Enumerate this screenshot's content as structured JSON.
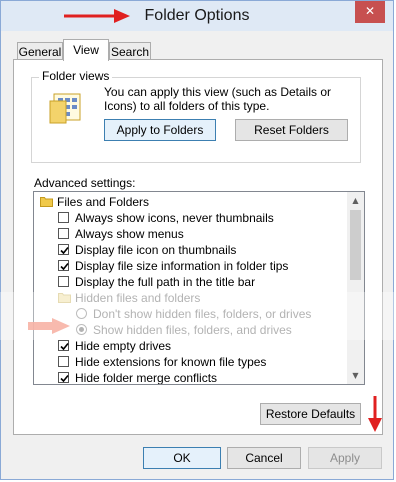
{
  "window": {
    "title": "Folder Options",
    "close_glyph": "✕"
  },
  "tabs": [
    {
      "label": "General",
      "active": false
    },
    {
      "label": "View",
      "active": true
    },
    {
      "label": "Search",
      "active": false
    }
  ],
  "folder_views": {
    "group_label": "Folder views",
    "description": "You can apply this view (such as Details or Icons) to all folders of this type.",
    "icon": "folder-view-icon",
    "apply_label": "Apply to Folders",
    "reset_label": "Reset Folders"
  },
  "advanced": {
    "label": "Advanced settings:",
    "items": [
      {
        "kind": "folder",
        "label": "Files and Folders",
        "grey": false
      },
      {
        "kind": "checkbox",
        "label": "Always show icons, never thumbnails",
        "checked": false,
        "grey": false
      },
      {
        "kind": "checkbox",
        "label": "Always show menus",
        "checked": false,
        "grey": false
      },
      {
        "kind": "checkbox",
        "label": "Display file icon on thumbnails",
        "checked": true,
        "grey": false
      },
      {
        "kind": "checkbox",
        "label": "Display file size information in folder tips",
        "checked": true,
        "grey": false
      },
      {
        "kind": "checkbox",
        "label": "Display the full path in the title bar",
        "checked": false,
        "grey": false
      },
      {
        "kind": "folder",
        "label": "Hidden files and folders",
        "grey": true
      },
      {
        "kind": "radio",
        "label": "Don't show hidden files, folders, or drives",
        "checked": false,
        "grey": true
      },
      {
        "kind": "radio",
        "label": "Show hidden files, folders, and drives",
        "checked": true,
        "grey": true
      },
      {
        "kind": "checkbox",
        "label": "Hide empty drives",
        "checked": true,
        "grey": false
      },
      {
        "kind": "checkbox",
        "label": "Hide extensions for known file types",
        "checked": false,
        "grey": false
      },
      {
        "kind": "checkbox",
        "label": "Hide folder merge conflicts",
        "checked": true,
        "grey": false
      }
    ]
  },
  "buttons": {
    "restore_defaults": "Restore Defaults",
    "ok": "OK",
    "cancel": "Cancel",
    "apply": "Apply"
  },
  "colors": {
    "annotation_red": "#e02020",
    "close_red": "#c75050",
    "titlebar": "#dfe9f5"
  }
}
